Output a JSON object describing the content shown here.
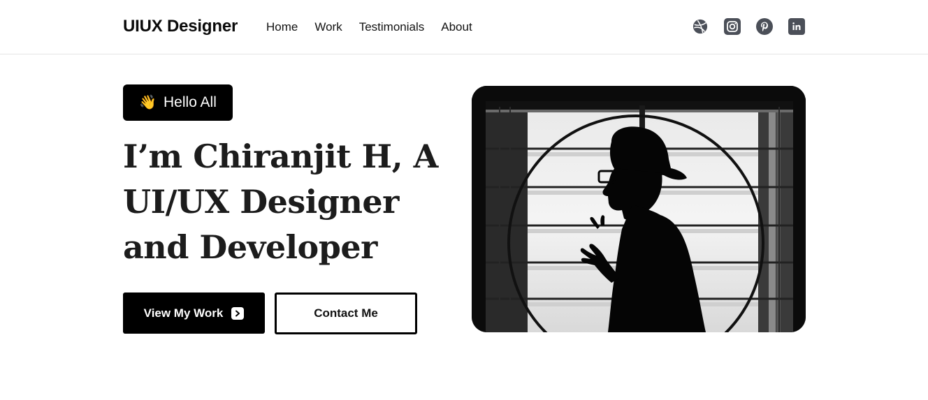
{
  "header": {
    "logo": "UIUX Designer",
    "nav": [
      {
        "label": "Home"
      },
      {
        "label": "Work"
      },
      {
        "label": "Testimonials"
      },
      {
        "label": "About"
      }
    ],
    "socials": [
      "dribbble-icon",
      "instagram-icon",
      "pinterest-icon",
      "linkedin-icon"
    ]
  },
  "hero": {
    "badge_emoji": "👋",
    "badge_text": "Hello All",
    "headline": "I’m Chiranjit H, A UI/UX Designer and Developer",
    "primary_button": "View My Work",
    "secondary_button": "Contact Me",
    "image_icon": "silhouette-portrait"
  },
  "colors": {
    "accent": "#000000",
    "icon_bg": "#4b4f58",
    "text": "#111111",
    "background": "#ffffff"
  }
}
